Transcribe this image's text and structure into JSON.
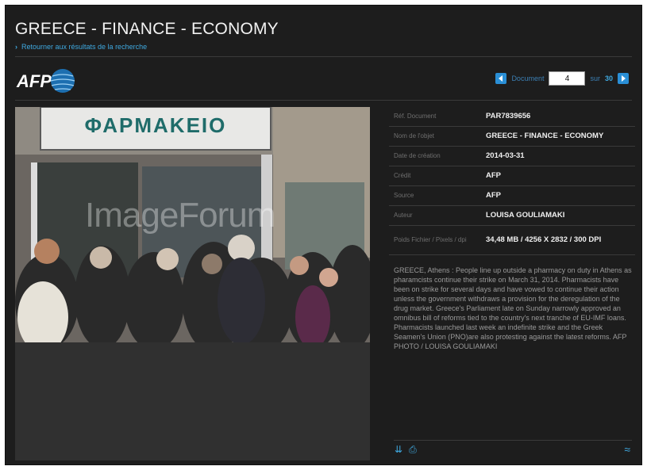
{
  "header": {
    "title": "GREECE - FINANCE - ECONOMY",
    "back_link": "Retourner aux résultats de la recherche",
    "logo_text": "AFP"
  },
  "pager": {
    "prev_icon": "left-arrow-icon",
    "document_label": "Document",
    "current": "4",
    "sur_label": "sur",
    "total": "30",
    "next_icon": "right-arrow-icon",
    "accent_color": "#2a8fd6"
  },
  "photo": {
    "sign_text": "ΦΑΡΜΑΚΕΙΟ",
    "watermark": "ImageForum"
  },
  "metadata": [
    {
      "key": "Réf. Document",
      "value": "PAR7839656"
    },
    {
      "key": "Nom de l'objet",
      "value": "GREECE - FINANCE - ECONOMY"
    },
    {
      "key": "Date de création",
      "value": "2014-03-31"
    },
    {
      "key": "Crédit",
      "value": "AFP"
    },
    {
      "key": "Source",
      "value": "AFP"
    },
    {
      "key": "Auteur",
      "value": "LOUISA GOULIAMAKI"
    },
    {
      "key": "Poids Fichier / Pixels / dpi",
      "value": "34,48 MB / 4256 X 2832 / 300 DPI"
    }
  ],
  "caption": "GREECE, Athens : People line up outside a pharmacy on duty in Athens as pharamcists continue their strike on March 31, 2014. Pharmacists have been on strike for several days and have vowed to continue their action unless the government withdraws a provision for the deregulation of the drug market. Greece's Parliament late on Sunday narrowly approved an omnibus bill of reforms tied to the country's next tranche of EU-IMF loans. Pharmacists launched last week an indefinite strike and the Greek Seamen's Union (PNO)are also protesting against the latest reforms. AFP PHOTO / LOUISA GOULIAMAKI",
  "tools": {
    "download_icon": "double-chevron-down-icon",
    "print_icon": "print-icon",
    "more_icon": "wave-icon"
  }
}
